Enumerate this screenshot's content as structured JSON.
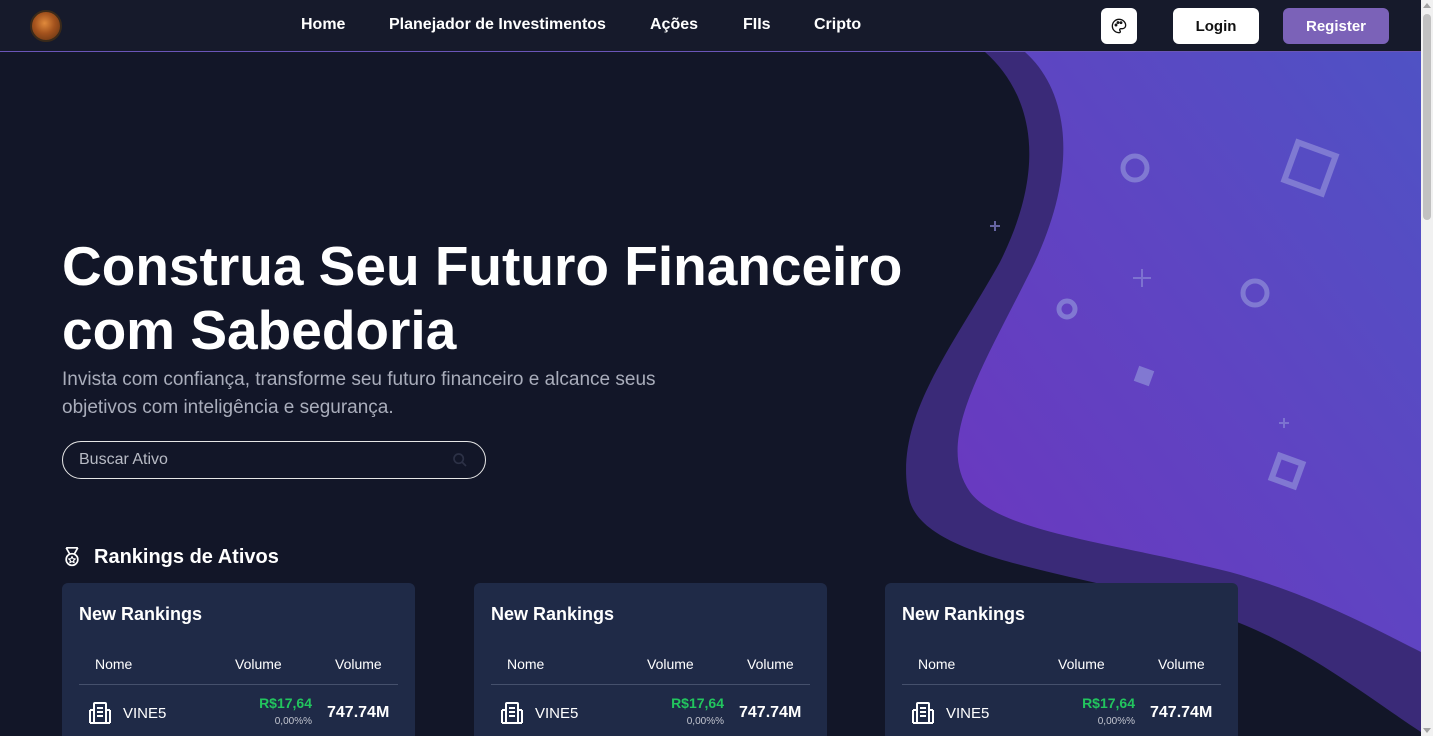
{
  "nav": {
    "links": [
      "Home",
      "Planejador de Investimentos",
      "Ações",
      "FIIs",
      "Cripto"
    ],
    "login_label": "Login",
    "register_label": "Register"
  },
  "hero": {
    "title": "Construa Seu Futuro Financeiro com Sabedoria",
    "subtitle": "Invista com confiança, transforme seu futuro financeiro e alcance seus objetivos com inteligência e segurança.",
    "search_placeholder": "Buscar Ativo"
  },
  "rankings": {
    "title": "Rankings de Ativos",
    "cards": [
      {
        "title": "New Rankings",
        "columns": [
          "Nome",
          "Volume",
          "Volume"
        ],
        "rows": [
          {
            "ticker": "VINE5",
            "price": "R$17,64",
            "change": "0,00%%",
            "volume": "747.74M"
          }
        ]
      },
      {
        "title": "New Rankings",
        "columns": [
          "Nome",
          "Volume",
          "Volume"
        ],
        "rows": [
          {
            "ticker": "VINE5",
            "price": "R$17,64",
            "change": "0,00%%",
            "volume": "747.74M"
          }
        ]
      },
      {
        "title": "New Rankings",
        "columns": [
          "Nome",
          "Volume",
          "Volume"
        ],
        "rows": [
          {
            "ticker": "VINE5",
            "price": "R$17,64",
            "change": "0,00%%",
            "volume": "747.74M"
          }
        ]
      }
    ]
  },
  "colors": {
    "background": "#121628",
    "navbar": "#161a2b",
    "card": "#1f2a47",
    "accent": "#7b62b8",
    "positive": "#22c55e"
  },
  "icons": [
    "logo-avatar",
    "palette-icon",
    "search-icon",
    "medal-icon",
    "building-icon"
  ]
}
